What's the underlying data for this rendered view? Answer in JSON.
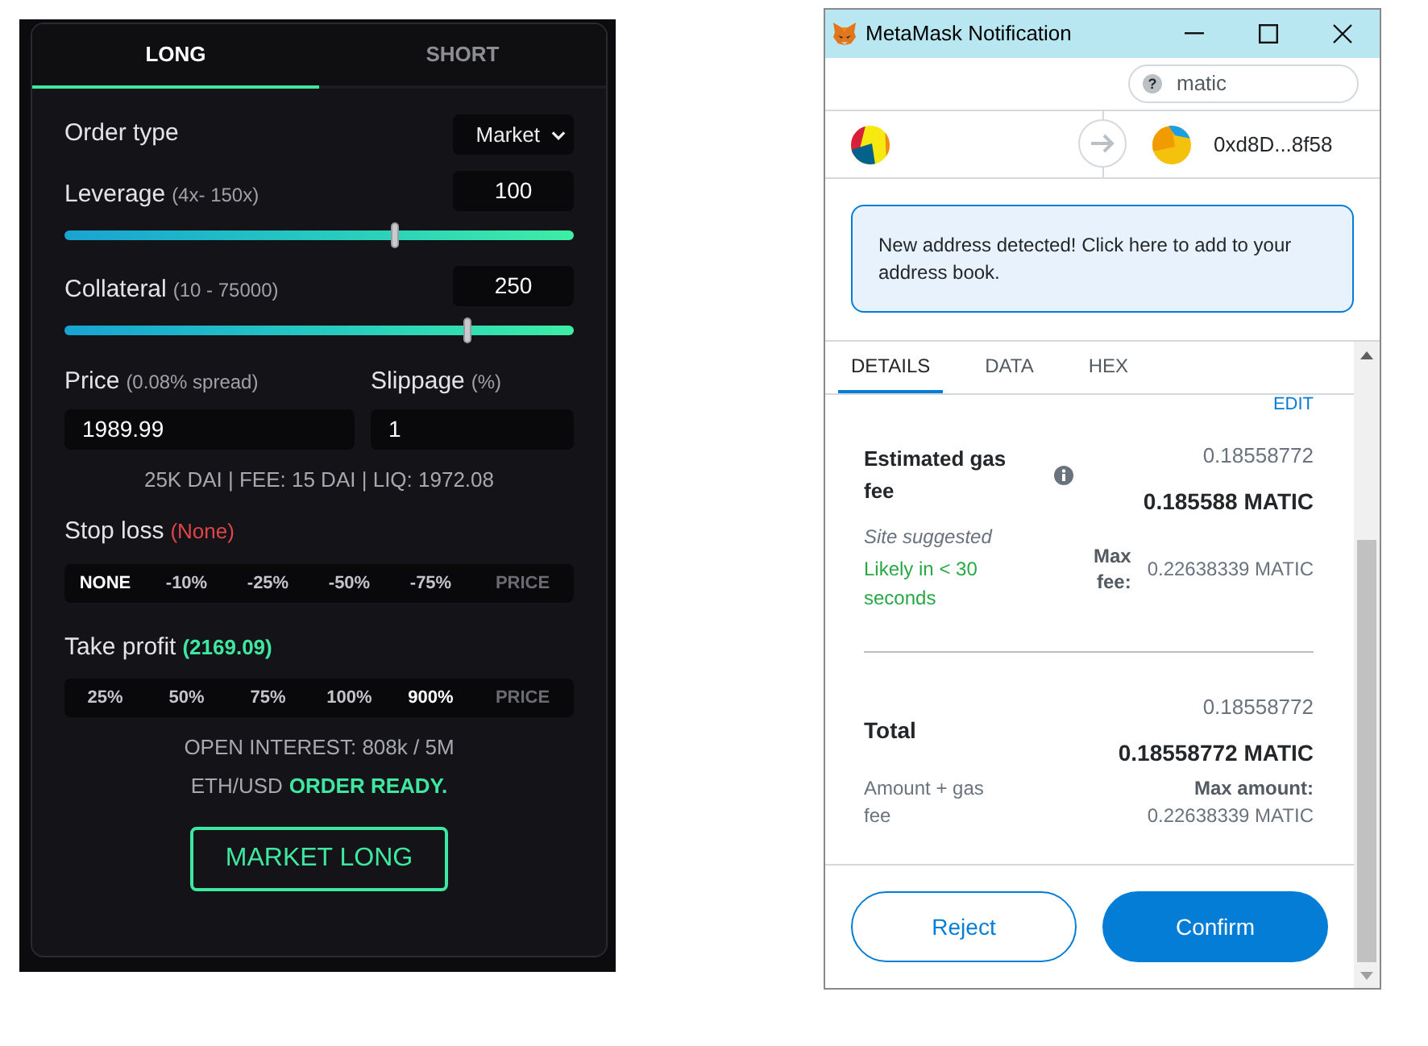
{
  "trade_panel": {
    "tabs": [
      {
        "label": "LONG",
        "selected": true
      },
      {
        "label": "SHORT",
        "selected": false
      }
    ],
    "order_type": {
      "label": "Order type",
      "value": "Market"
    },
    "leverage": {
      "label": "Leverage",
      "hint": "(4x- 150x)",
      "value": "100",
      "level": 0.65
    },
    "collateral": {
      "label": "Collateral",
      "hint": "(10 - 75000)",
      "value": "250",
      "level": 0.79
    },
    "price": {
      "label": "Price",
      "hint": "(0.08% spread)",
      "value": "1989.99"
    },
    "slippage": {
      "label": "Slippage",
      "hint": "(%)",
      "value": "1"
    },
    "summary": "25K DAI | FEE: 15 DAI | LIQ: 1972.08",
    "stop_loss": {
      "label": "Stop loss",
      "value": "(None)",
      "options": [
        {
          "label": "NONE",
          "kind": "preset",
          "selected": true
        },
        {
          "label": "-10%",
          "kind": "preset",
          "selected": false
        },
        {
          "label": "-25%",
          "kind": "preset",
          "selected": false
        },
        {
          "label": "-50%",
          "kind": "preset",
          "selected": false
        },
        {
          "label": "-75%",
          "kind": "preset",
          "selected": false
        },
        {
          "label": "PRICE",
          "kind": "price",
          "selected": false
        }
      ]
    },
    "take_profit": {
      "label": "Take profit",
      "value": "(2169.09)",
      "options": [
        {
          "label": "25%",
          "kind": "preset",
          "selected": false
        },
        {
          "label": "50%",
          "kind": "preset",
          "selected": false
        },
        {
          "label": "75%",
          "kind": "preset",
          "selected": false
        },
        {
          "label": "100%",
          "kind": "preset",
          "selected": false
        },
        {
          "label": "900%",
          "kind": "preset",
          "selected": true
        },
        {
          "label": "PRICE",
          "kind": "price",
          "selected": false
        }
      ]
    },
    "open_interest": "OPEN INTEREST: 808k / 5M",
    "status": {
      "pair": "ETH/USD",
      "message": "ORDER READY."
    },
    "submit_button": "MARKET LONG"
  },
  "metamask_window": {
    "title": "MetaMask Notification",
    "network": {
      "icon": "?",
      "name": "matic"
    },
    "recipient": "0xd8D...8f58",
    "alert": "New address detected! Click here to add to your address book.",
    "tabs": [
      {
        "label": "DETAILS",
        "selected": true
      },
      {
        "label": "DATA",
        "selected": false
      },
      {
        "label": "HEX",
        "selected": false
      }
    ],
    "edit_link": "EDIT",
    "gas_fee": {
      "label": "Estimated gas fee",
      "amount": "0.18558772",
      "amount_total": "0.185588 MATIC",
      "source": "Site suggested",
      "timing": "Likely in < 30 seconds",
      "max_label": "Max fee:",
      "max_value": "0.22638339 MATIC"
    },
    "total": {
      "label": "Total",
      "amount": "0.18558772",
      "amount_total": "0.18558772 MATIC",
      "caption": "Amount + gas fee",
      "max_label": "Max amount:",
      "max_value": "0.22638339 MATIC"
    },
    "buttons": [
      {
        "label": "Reject",
        "kind": "secondary"
      },
      {
        "label": "Confirm",
        "kind": "primary"
      }
    ]
  }
}
